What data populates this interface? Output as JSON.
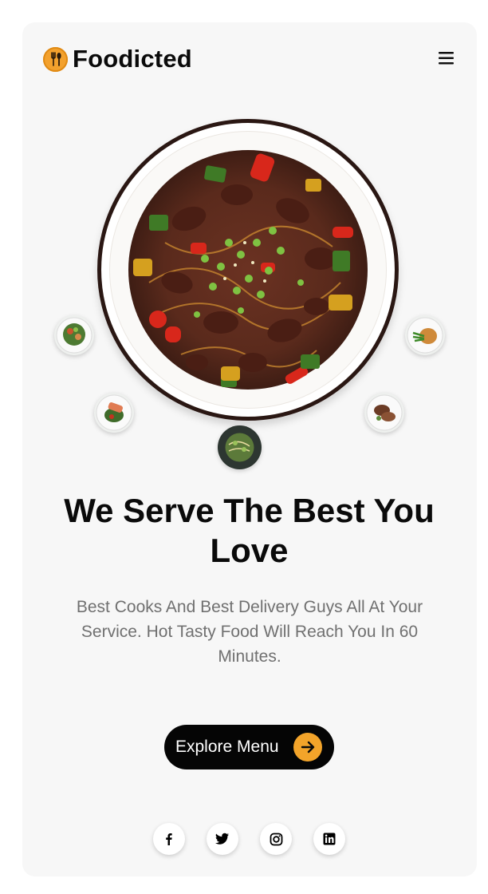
{
  "brand": {
    "name": "Foodicted",
    "logo_icon": "fork-spoon-icon",
    "accent": "#f3a12d"
  },
  "header": {
    "menu_icon": "hamburger-menu-icon"
  },
  "hero": {
    "main_dish": "stir-fry-beef-noodle-plate",
    "thumbnails": [
      "salad-plate-thumbnail",
      "salmon-salad-thumbnail",
      "green-noodle-bowl-thumbnail",
      "grilled-meat-thumbnail",
      "noodle-greens-thumbnail"
    ],
    "headline": "We Serve The Best You Love",
    "subtext": "Best Cooks And Best Delivery Guys All At Your Service. Hot Tasty Food Will Reach You In 60 Minutes."
  },
  "cta": {
    "label": "Explore Menu",
    "icon": "arrow-right-icon",
    "button_color": "#050505",
    "icon_color": "#f3a42a"
  },
  "socials": [
    {
      "icon": "facebook-icon"
    },
    {
      "icon": "twitter-icon"
    },
    {
      "icon": "instagram-icon"
    },
    {
      "icon": "linkedin-icon"
    }
  ]
}
